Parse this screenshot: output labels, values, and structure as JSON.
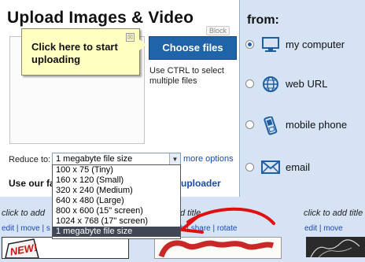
{
  "upload": {
    "title": "Upload Images & Video",
    "tooltip_text": "Click here to start uploading",
    "tooltip_close": "☒",
    "block_tag": "Block",
    "choose_files": "Choose files",
    "ctrl_hint": "Use CTRL to select multiple files",
    "reduce_label": "Reduce to:",
    "reduce_selected": "1 megabyte file size",
    "more_options": "more options",
    "use_our_prefix": "Use our fa",
    "uploader_suffix": "uploader",
    "reduce_options": [
      "100 x 75 (Tiny)",
      "160 x 120 (Small)",
      "320 x 240 (Medium)",
      "640 x 480 (Large)",
      "800 x 600 (15\" screen)",
      "1024 x 768 (17\" screen)",
      "1 megabyte file size"
    ],
    "highlighted_option": 6
  },
  "sources": {
    "from_label": "from:",
    "items": [
      {
        "label": "my computer",
        "icon": "monitor-icon",
        "selected": true
      },
      {
        "label": "web URL",
        "icon": "globe-icon",
        "selected": false
      },
      {
        "label": "mobile phone",
        "icon": "mobile-phone-icon",
        "selected": false
      },
      {
        "label": "email",
        "icon": "envelope-icon",
        "selected": false
      }
    ]
  },
  "gallery": {
    "captions": [
      "click to add",
      "d title",
      "click to add title"
    ],
    "links": [
      "edit | move | s",
      "h | share | rotate",
      "edit | move"
    ]
  },
  "colors": {
    "accent": "#1f63a9",
    "tooltip_bg": "#ffffc2",
    "page_bg": "#d6e3f4",
    "annotation_arrow": "#e01010"
  }
}
